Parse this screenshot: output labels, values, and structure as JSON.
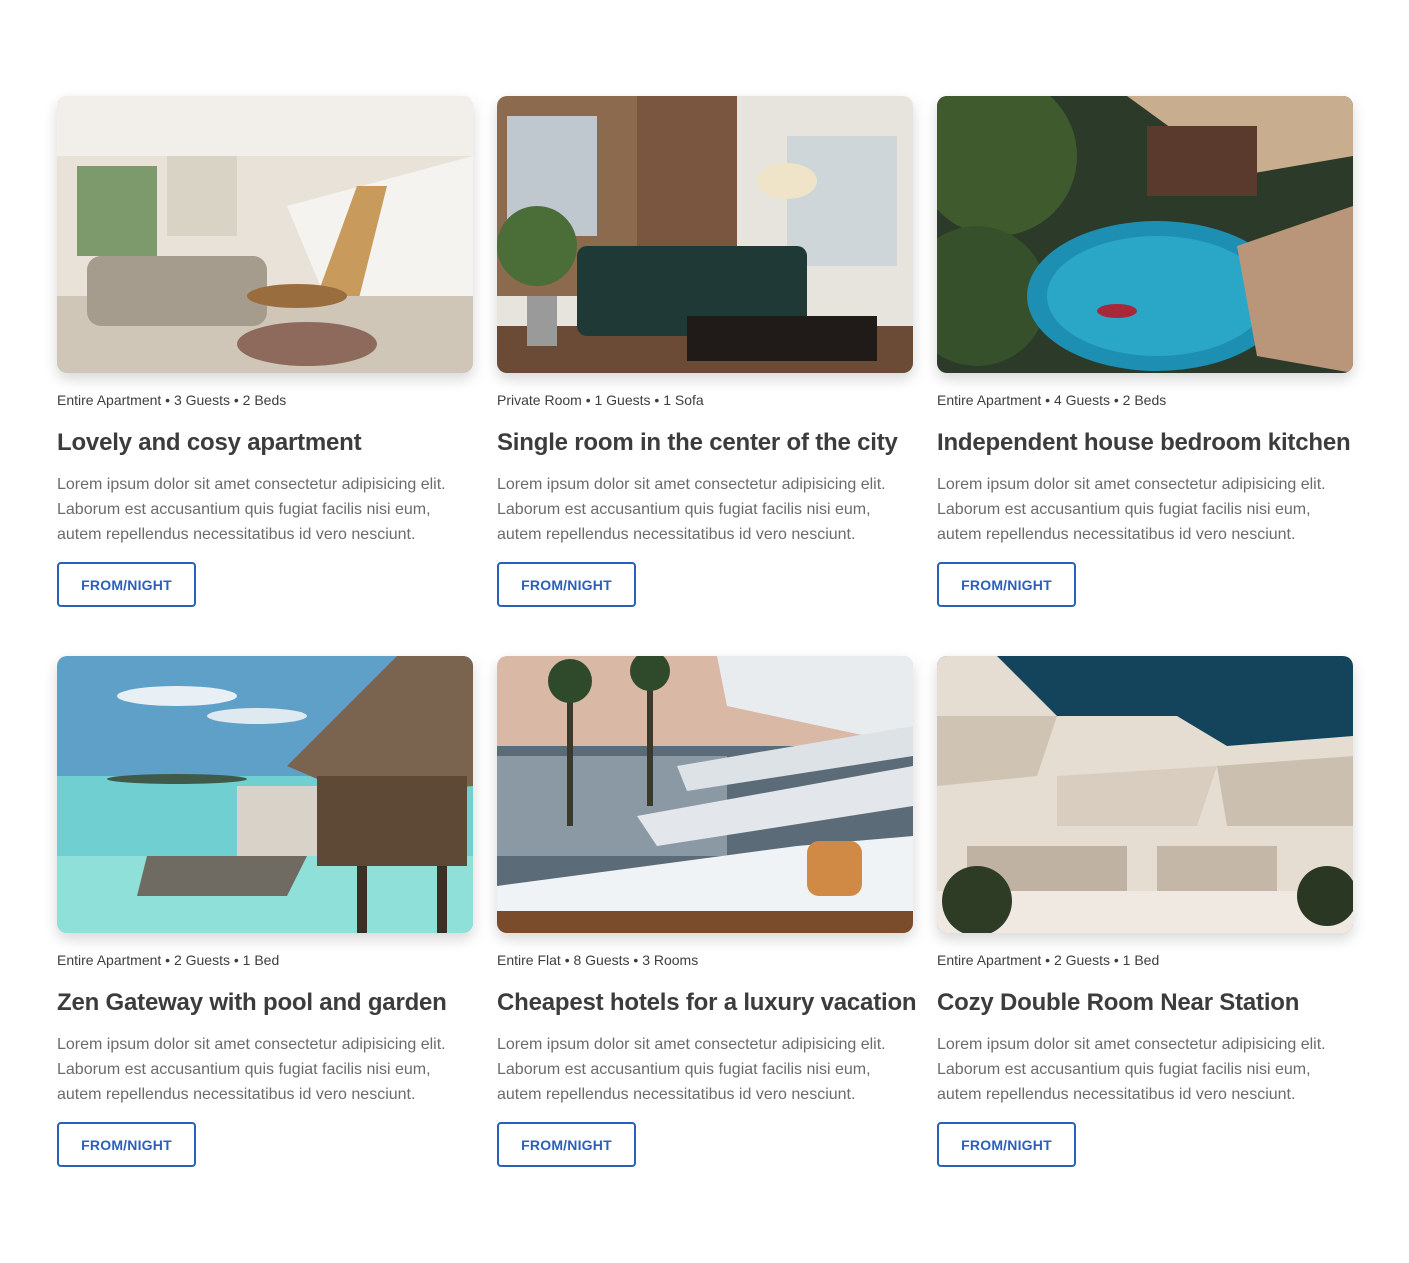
{
  "listings": [
    {
      "meta": "Entire Apartment • 3 Guests • 2 Beds",
      "title": "Lovely and cosy apartment",
      "description": "Lorem ipsum dolor sit amet consectetur adipisicing elit. Laborum est accusantium quis fugiat facilis nisi eum, autem repellendus necessitatibus id vero nesciunt.",
      "button_label": "FROM/NIGHT"
    },
    {
      "meta": "Private Room • 1 Guests • 1 Sofa",
      "title": "Single room in the center of the city",
      "description": "Lorem ipsum dolor sit amet consectetur adipisicing elit. Laborum est accusantium quis fugiat facilis nisi eum, autem repellendus necessitatibus id vero nesciunt.",
      "button_label": "FROM/NIGHT"
    },
    {
      "meta": "Entire Apartment • 4 Guests • 2 Beds",
      "title": "Independent house bedroom kitchen",
      "description": "Lorem ipsum dolor sit amet consectetur adipisicing elit. Laborum est accusantium quis fugiat facilis nisi eum, autem repellendus necessitatibus id vero nesciunt.",
      "button_label": "FROM/NIGHT"
    },
    {
      "meta": "Entire Apartment • 2 Guests • 1 Bed",
      "title": "Zen Gateway with pool and garden",
      "description": "Lorem ipsum dolor sit amet consectetur adipisicing elit. Laborum est accusantium quis fugiat facilis nisi eum, autem repellendus necessitatibus id vero nesciunt.",
      "button_label": "FROM/NIGHT"
    },
    {
      "meta": "Entire Flat • 8 Guests • 3 Rooms",
      "title": "Cheapest hotels for a luxury vacation",
      "description": "Lorem ipsum dolor sit amet consectetur adipisicing elit. Laborum est accusantium quis fugiat facilis nisi eum, autem repellendus necessitatibus id vero nesciunt.",
      "button_label": "FROM/NIGHT"
    },
    {
      "meta": "Entire Apartment • 2 Guests • 1 Bed",
      "title": "Cozy Double Room Near Station",
      "description": "Lorem ipsum dolor sit amet consectetur adipisicing elit. Laborum est accusantium quis fugiat facilis nisi eum, autem repellendus necessitatibus id vero nesciunt.",
      "button_label": "FROM/NIGHT"
    }
  ],
  "colors": {
    "accent": "#2c5fb8",
    "title": "#3c3c3c",
    "body_text": "#6b6b6b"
  }
}
